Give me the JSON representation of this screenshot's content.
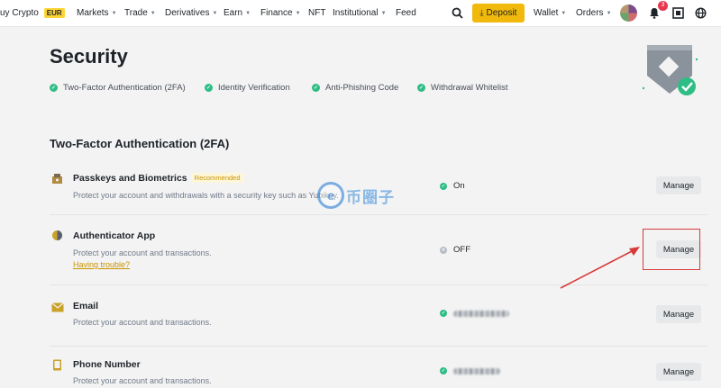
{
  "nav": {
    "buy_crypto": "uy Crypto",
    "currency": "EUR",
    "markets": "Markets",
    "trade": "Trade",
    "derivatives": "Derivatives",
    "earn": "Earn",
    "finance": "Finance",
    "nft": "NFT",
    "institutional": "Institutional",
    "feed": "Feed",
    "deposit": "Deposit",
    "wallet": "Wallet",
    "orders": "Orders",
    "notification_count": "3",
    "icons": [
      "search-icon",
      "download-icon",
      "bell-icon",
      "qr-scan-icon",
      "globe-icon"
    ]
  },
  "page": {
    "title": "Security",
    "checks": [
      "Two-Factor Authentication (2FA)",
      "Identity Verification",
      "Anti-Phishing Code",
      "Withdrawal Whitelist"
    ]
  },
  "section": {
    "title": "Two-Factor Authentication (2FA)"
  },
  "rows": [
    {
      "title": "Passkeys and Biometrics",
      "badge": "Recommended",
      "desc": "Protect your account and withdrawals with a security key such as Yubikey.",
      "status": "On",
      "action": "Manage",
      "icon": "passkey-icon"
    },
    {
      "title": "Authenticator App",
      "desc": "Protect your account and transactions.",
      "link": "Having trouble?",
      "status": "OFF",
      "action": "Manage",
      "icon": "authenticator-icon"
    },
    {
      "title": "Email",
      "desc": "Protect your account and transactions.",
      "action": "Manage",
      "icon": "email-icon"
    },
    {
      "title": "Phone Number",
      "desc": "Protect your account and transactions.",
      "action": "Manage",
      "icon": "phone-icon"
    }
  ],
  "watermark": {
    "text": "币圈子"
  },
  "colors": {
    "brand": "#f0b90b",
    "success": "#2ebd85",
    "annotation": "#d83a3a"
  }
}
